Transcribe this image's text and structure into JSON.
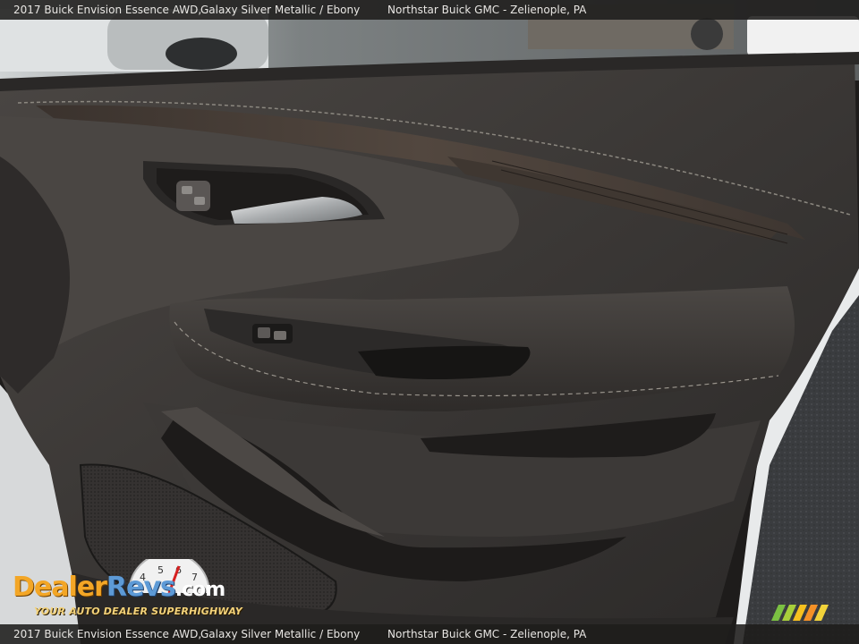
{
  "caption": {
    "model": "2017 Buick Envision Essence AWD,",
    "color": "Galaxy Silver Metallic / Ebony",
    "dealer": "Northstar Buick GMC - Zelienople, PA"
  },
  "watermark": {
    "brand_part1": "Dealer",
    "brand_part2": "Revs",
    "brand_part3": ".com",
    "tagline": "YOUR AUTO DEALER SUPERHIGHWAY"
  },
  "colors": {
    "door_panel": "#3b3836",
    "wood_trim": "#4a403a",
    "window": "#8a8d8e",
    "watermark_orange": "#f3a626",
    "watermark_blue": "#5d9ad6"
  }
}
